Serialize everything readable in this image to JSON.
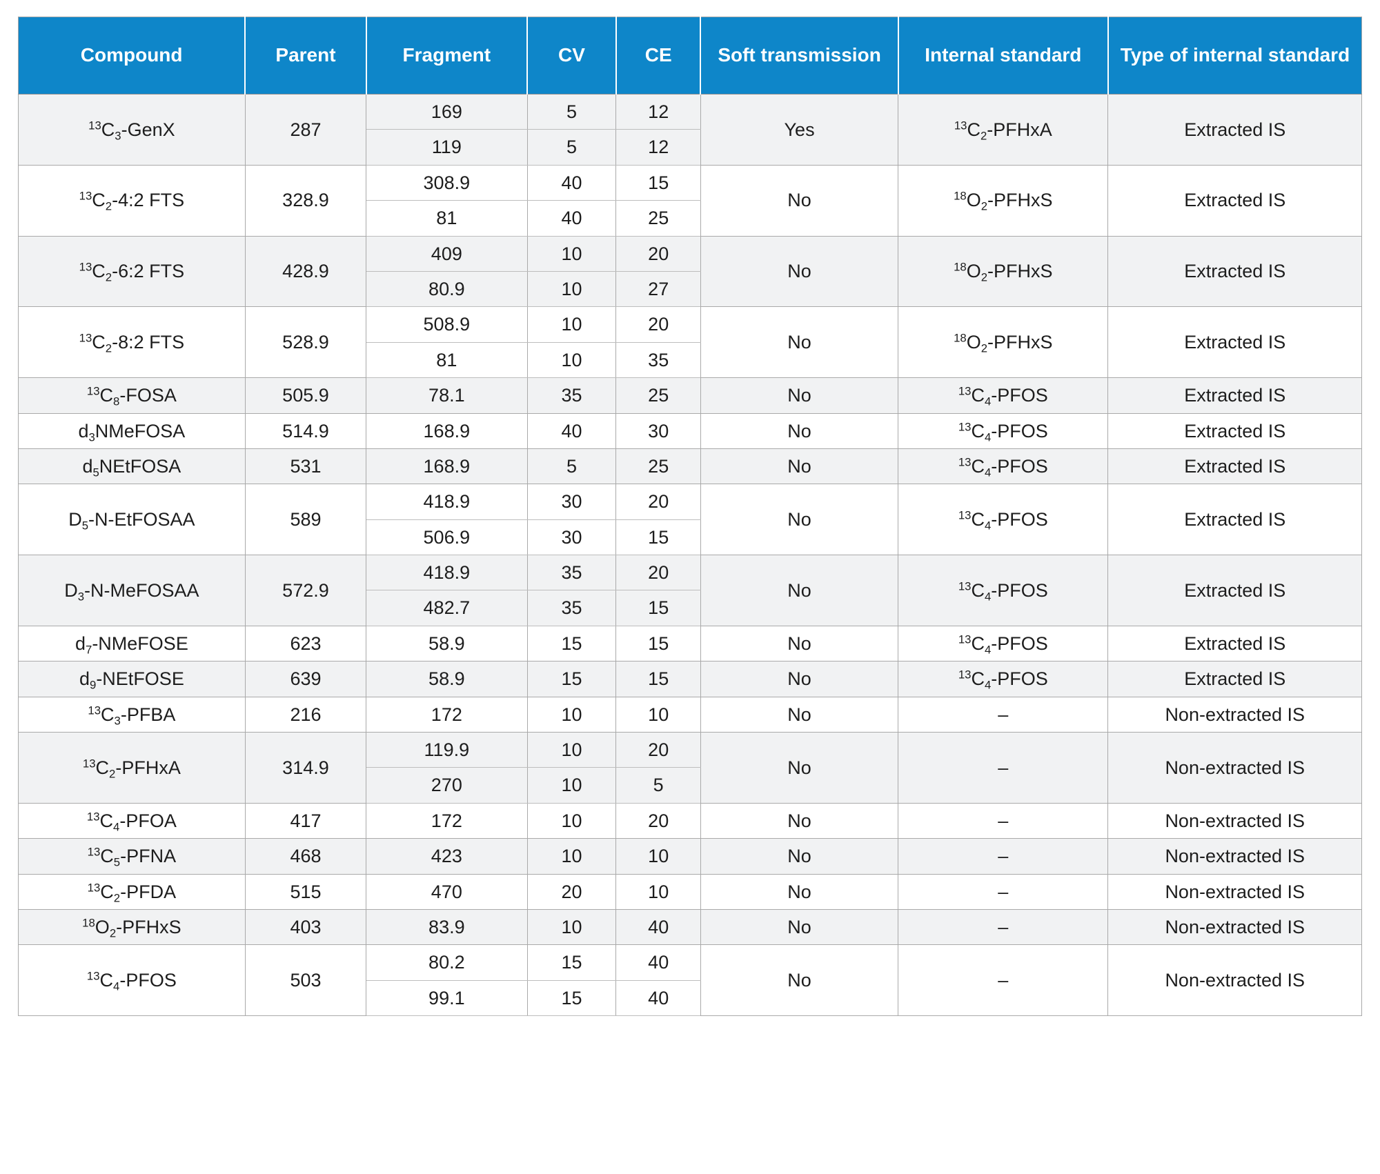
{
  "table": {
    "headers": [
      "Compound",
      "Parent",
      "Fragment",
      "CV",
      "CE",
      "Soft transmission",
      "Internal standard",
      "Type of internal standard"
    ],
    "header_colors": {
      "background": "#0e86c9",
      "text": "#ffffff"
    },
    "row_colors": {
      "shaded": "#f1f2f3",
      "plain": "#ffffff",
      "border": "#a9a9a9"
    },
    "rows": [
      {
        "compound_html": "<sup>13</sup>C<sub>3</sub>-GenX",
        "compound_text": "13C3-GenX",
        "parent": "287",
        "transitions": [
          {
            "fragment": "169",
            "cv": "5",
            "ce": "12"
          },
          {
            "fragment": "119",
            "cv": "5",
            "ce": "12"
          }
        ],
        "soft_transmission": "Yes",
        "internal_standard_html": "<sup>13</sup>C<sub>2</sub>-PFHxA",
        "internal_standard_text": "13C2-PFHxA",
        "type_of_internal_standard": "Extracted IS"
      },
      {
        "compound_html": "<sup>13</sup>C<sub>2</sub>-4:2 FTS",
        "compound_text": "13C2-4:2 FTS",
        "parent": "328.9",
        "transitions": [
          {
            "fragment": "308.9",
            "cv": "40",
            "ce": "15"
          },
          {
            "fragment": "81",
            "cv": "40",
            "ce": "25"
          }
        ],
        "soft_transmission": "No",
        "internal_standard_html": "<sup>18</sup>O<sub>2</sub>-PFHxS",
        "internal_standard_text": "18O2-PFHxS",
        "type_of_internal_standard": "Extracted IS"
      },
      {
        "compound_html": "<sup>13</sup>C<sub>2</sub>-6:2 FTS",
        "compound_text": "13C2-6:2 FTS",
        "parent": "428.9",
        "transitions": [
          {
            "fragment": "409",
            "cv": "10",
            "ce": "20"
          },
          {
            "fragment": "80.9",
            "cv": "10",
            "ce": "27"
          }
        ],
        "soft_transmission": "No",
        "internal_standard_html": "<sup>18</sup>O<sub>2</sub>-PFHxS",
        "internal_standard_text": "18O2-PFHxS",
        "type_of_internal_standard": "Extracted IS"
      },
      {
        "compound_html": "<sup>13</sup>C<sub>2</sub>-8:2 FTS",
        "compound_text": "13C2-8:2 FTS",
        "parent": "528.9",
        "transitions": [
          {
            "fragment": "508.9",
            "cv": "10",
            "ce": "20"
          },
          {
            "fragment": "81",
            "cv": "10",
            "ce": "35"
          }
        ],
        "soft_transmission": "No",
        "internal_standard_html": "<sup>18</sup>O<sub>2</sub>-PFHxS",
        "internal_standard_text": "18O2-PFHxS",
        "type_of_internal_standard": "Extracted IS"
      },
      {
        "compound_html": "<sup>13</sup>C<sub>8</sub>-FOSA",
        "compound_text": "13C8-FOSA",
        "parent": "505.9",
        "transitions": [
          {
            "fragment": "78.1",
            "cv": "35",
            "ce": "25"
          }
        ],
        "soft_transmission": "No",
        "internal_standard_html": "<sup>13</sup>C<sub>4</sub>-PFOS",
        "internal_standard_text": "13C4-PFOS",
        "type_of_internal_standard": "Extracted IS"
      },
      {
        "compound_html": "d<sub>3</sub>NMeFOSA",
        "compound_text": "d3NMeFOSA",
        "parent": "514.9",
        "transitions": [
          {
            "fragment": "168.9",
            "cv": "40",
            "ce": "30"
          }
        ],
        "soft_transmission": "No",
        "internal_standard_html": "<sup>13</sup>C<sub>4</sub>-PFOS",
        "internal_standard_text": "13C4-PFOS",
        "type_of_internal_standard": "Extracted IS"
      },
      {
        "compound_html": "d<sub>5</sub>NEtFOSA",
        "compound_text": "d5NEtFOSA",
        "parent": "531",
        "transitions": [
          {
            "fragment": "168.9",
            "cv": "5",
            "ce": "25"
          }
        ],
        "soft_transmission": "No",
        "internal_standard_html": "<sup>13</sup>C<sub>4</sub>-PFOS",
        "internal_standard_text": "13C4-PFOS",
        "type_of_internal_standard": "Extracted IS"
      },
      {
        "compound_html": "D<sub>5</sub>-N-EtFOSAA",
        "compound_text": "D5-N-EtFOSAA",
        "parent": "589",
        "transitions": [
          {
            "fragment": "418.9",
            "cv": "30",
            "ce": "20"
          },
          {
            "fragment": "506.9",
            "cv": "30",
            "ce": "15"
          }
        ],
        "soft_transmission": "No",
        "internal_standard_html": "<sup>13</sup>C<sub>4</sub>-PFOS",
        "internal_standard_text": "13C4-PFOS",
        "type_of_internal_standard": "Extracted IS"
      },
      {
        "compound_html": "D<sub>3</sub>-N-MeFOSAA",
        "compound_text": "D3-N-MeFOSAA",
        "parent": "572.9",
        "transitions": [
          {
            "fragment": "418.9",
            "cv": "35",
            "ce": "20"
          },
          {
            "fragment": "482.7",
            "cv": "35",
            "ce": "15"
          }
        ],
        "soft_transmission": "No",
        "internal_standard_html": "<sup>13</sup>C<sub>4</sub>-PFOS",
        "internal_standard_text": "13C4-PFOS",
        "type_of_internal_standard": "Extracted IS"
      },
      {
        "compound_html": "d<sub>7</sub>-NMeFOSE",
        "compound_text": "d7-NMeFOSE",
        "parent": "623",
        "transitions": [
          {
            "fragment": "58.9",
            "cv": "15",
            "ce": "15"
          }
        ],
        "soft_transmission": "No",
        "internal_standard_html": "<sup>13</sup>C<sub>4</sub>-PFOS",
        "internal_standard_text": "13C4-PFOS",
        "type_of_internal_standard": "Extracted IS"
      },
      {
        "compound_html": "d<sub>9</sub>-NEtFOSE",
        "compound_text": "d9-NEtFOSE",
        "parent": "639",
        "transitions": [
          {
            "fragment": "58.9",
            "cv": "15",
            "ce": "15"
          }
        ],
        "soft_transmission": "No",
        "internal_standard_html": "<sup>13</sup>C<sub>4</sub>-PFOS",
        "internal_standard_text": "13C4-PFOS",
        "type_of_internal_standard": "Extracted IS"
      },
      {
        "compound_html": "<sup>13</sup>C<sub>3</sub>-PFBA",
        "compound_text": "13C3-PFBA",
        "parent": "216",
        "transitions": [
          {
            "fragment": "172",
            "cv": "10",
            "ce": "10"
          }
        ],
        "soft_transmission": "No",
        "internal_standard_html": "&#8211;",
        "internal_standard_text": "–",
        "type_of_internal_standard": "Non-extracted IS"
      },
      {
        "compound_html": "<sup>13</sup>C<sub>2</sub>-PFHxA",
        "compound_text": "13C2-PFHxA",
        "parent": "314.9",
        "transitions": [
          {
            "fragment": "119.9",
            "cv": "10",
            "ce": "20"
          },
          {
            "fragment": "270",
            "cv": "10",
            "ce": "5"
          }
        ],
        "soft_transmission": "No",
        "internal_standard_html": "&#8211;",
        "internal_standard_text": "–",
        "type_of_internal_standard": "Non-extracted IS"
      },
      {
        "compound_html": "<sup>13</sup>C<sub>4</sub>-PFOA",
        "compound_text": "13C4-PFOA",
        "parent": "417",
        "transitions": [
          {
            "fragment": "172",
            "cv": "10",
            "ce": "20"
          }
        ],
        "soft_transmission": "No",
        "internal_standard_html": "&#8211;",
        "internal_standard_text": "–",
        "type_of_internal_standard": "Non-extracted IS"
      },
      {
        "compound_html": "<sup>13</sup>C<sub>5</sub>-PFNA",
        "compound_text": "13C5-PFNA",
        "parent": "468",
        "transitions": [
          {
            "fragment": "423",
            "cv": "10",
            "ce": "10"
          }
        ],
        "soft_transmission": "No",
        "internal_standard_html": "&#8211;",
        "internal_standard_text": "–",
        "type_of_internal_standard": "Non-extracted IS"
      },
      {
        "compound_html": "<sup>13</sup>C<sub>2</sub>-PFDA",
        "compound_text": "13C2-PFDA",
        "parent": "515",
        "transitions": [
          {
            "fragment": "470",
            "cv": "20",
            "ce": "10"
          }
        ],
        "soft_transmission": "No",
        "internal_standard_html": "&#8211;",
        "internal_standard_text": "–",
        "type_of_internal_standard": "Non-extracted IS"
      },
      {
        "compound_html": "<sup>18</sup>O<sub>2</sub>-PFHxS",
        "compound_text": "18O2-PFHxS",
        "parent": "403",
        "transitions": [
          {
            "fragment": "83.9",
            "cv": "10",
            "ce": "40"
          }
        ],
        "soft_transmission": "No",
        "internal_standard_html": "&#8211;",
        "internal_standard_text": "–",
        "type_of_internal_standard": "Non-extracted IS"
      },
      {
        "compound_html": "<sup>13</sup>C<sub>4</sub>-PFOS",
        "compound_text": "13C4-PFOS",
        "parent": "503",
        "transitions": [
          {
            "fragment": "80.2",
            "cv": "15",
            "ce": "40"
          },
          {
            "fragment": "99.1",
            "cv": "15",
            "ce": "40"
          }
        ],
        "soft_transmission": "No",
        "internal_standard_html": "&#8211;",
        "internal_standard_text": "–",
        "type_of_internal_standard": "Non-extracted IS"
      }
    ]
  }
}
